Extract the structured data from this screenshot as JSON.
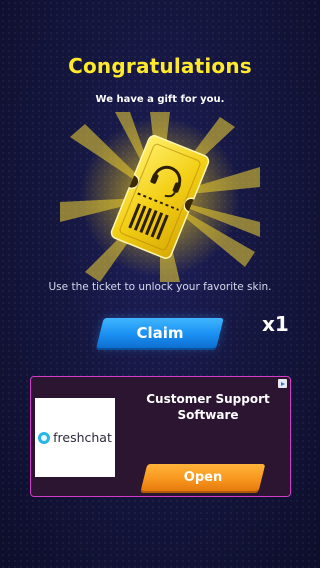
{
  "dialog": {
    "title": "Congratulations",
    "subtitle": "We have a gift for you.",
    "reward_quantity": "x1",
    "description": "Use the ticket to unlock your favorite skin.",
    "claim_label": "Claim"
  },
  "ad": {
    "brand_logo_text": "freshchat",
    "headline": "Customer Support Software",
    "open_label": "Open",
    "badge_icon": "ad-choices-icon"
  },
  "colors": {
    "title": "#ffe92a",
    "claim_button": "#1a8ff2",
    "ad_border": "#d23cc7",
    "open_button": "#f7941d",
    "ticket_gold": "#f5d21a"
  }
}
